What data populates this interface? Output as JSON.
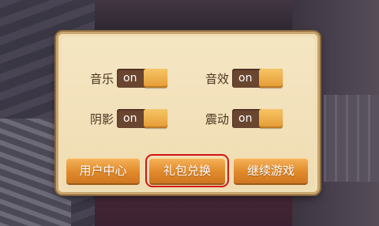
{
  "settings": {
    "music": {
      "label": "音乐",
      "state": "on"
    },
    "sound_effects": {
      "label": "音效",
      "state": "on"
    },
    "shadows": {
      "label": "阴影",
      "state": "on"
    },
    "vibration": {
      "label": "震动",
      "state": "on"
    }
  },
  "buttons": {
    "user_center": "用户中心",
    "gift_redeem": "礼包兑换",
    "continue_game": "继续游戏"
  },
  "colors": {
    "panel_bg": "#f1dfb7",
    "toggle_track": "#6a4630",
    "toggle_knob": "#eba43f",
    "button_orange": "#e08a2c",
    "highlight_box": "#d41414"
  }
}
